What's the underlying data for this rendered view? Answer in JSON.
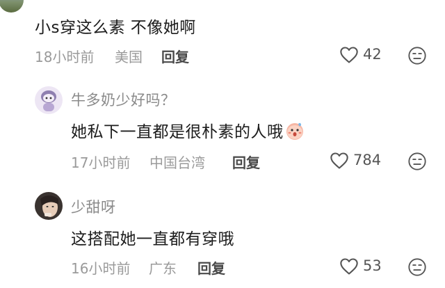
{
  "comments": [
    {
      "text": "小s穿这么素 不像她啊",
      "time": "18小时前",
      "location": "美国",
      "reply": "回复",
      "likes": "42"
    },
    {
      "username": "牛多奶少好吗？",
      "text": "她私下一直都是很朴素的人哦",
      "time": "17小时前",
      "location": "中国台湾",
      "reply": "回复",
      "likes": "784"
    },
    {
      "username": "少甜呀",
      "text": "这搭配她一直都有穿哦",
      "time": "16小时前",
      "location": "广东",
      "reply": "回复",
      "likes": "53"
    }
  ],
  "icons": {
    "like": "heart-outline-icon",
    "dislike": "meh-face-icon",
    "emoji": "surprised-face-emoji"
  },
  "colors": {
    "meta": "#9a9a9a",
    "text": "#1c1c1c"
  }
}
